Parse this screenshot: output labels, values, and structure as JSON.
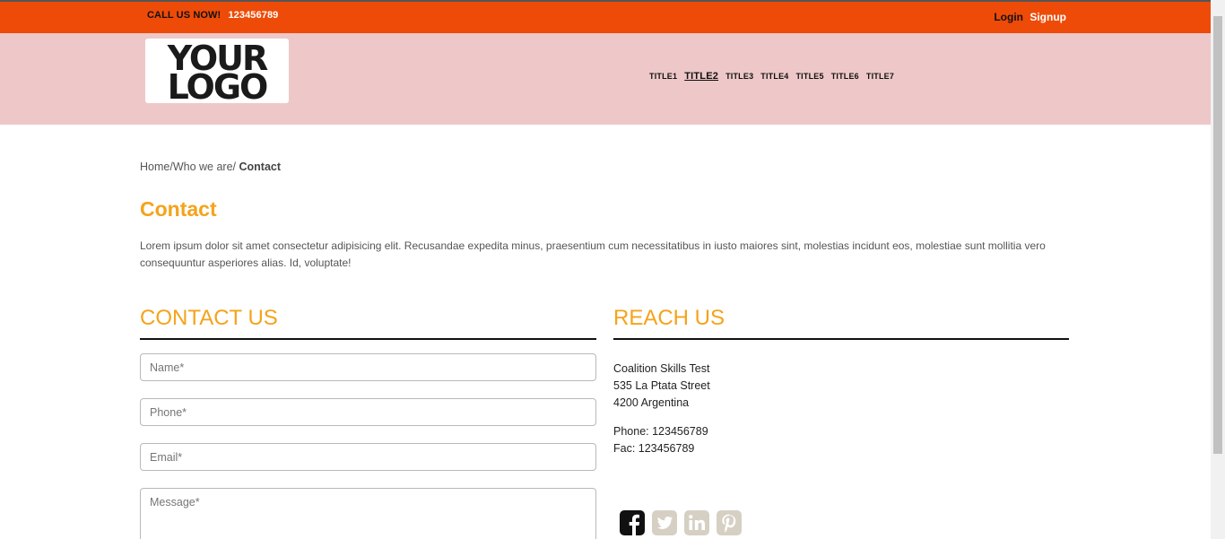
{
  "topbar": {
    "call_label": "CALL US NOW!",
    "phone": "123456789",
    "login": "Login",
    "signup": "Signup"
  },
  "logo": {
    "line1": "YOUR",
    "line2": "LOGO"
  },
  "nav": {
    "items": [
      "TITLE1",
      "TITLE2",
      "TITLE3",
      "TITLE4",
      "TITLE5",
      "TITLE6",
      "TITLE7"
    ],
    "active": "TITLE2"
  },
  "breadcrumb": {
    "home": "Home",
    "sep1": "/",
    "who": "Who we are",
    "sep2": "/ ",
    "current": "Contact"
  },
  "page": {
    "title": "Contact",
    "intro": "Lorem ipsum dolor sit amet consectetur adipisicing elit. Recusandae expedita minus, praesentium cum necessitatibus in iusto maiores sint, molestias incidunt eos, molestiae sunt mollitia vero consequuntur asperiores alias. Id, voluptate!"
  },
  "contact": {
    "heading": "CONTACT US",
    "name_placeholder": "Name*",
    "phone_placeholder": "Phone*",
    "email_placeholder": "Email*",
    "message_placeholder": "Message*"
  },
  "reach": {
    "heading": "REACH US",
    "org": "Coalition Skills Test",
    "street": "535 La Ptata Street",
    "city": "4200 Argentina",
    "phone": "Phone: 123456789",
    "fax": "Fac: 123456789"
  },
  "social": {
    "icons": [
      "facebook-icon",
      "twitter-icon",
      "linkedin-icon",
      "pinterest-icon"
    ]
  },
  "colors": {
    "topbar": "#ee4b08",
    "header": "#eec8c8",
    "accent": "#f5a31a",
    "facebook": "#111111",
    "social_muted": "#d6d0c4"
  }
}
